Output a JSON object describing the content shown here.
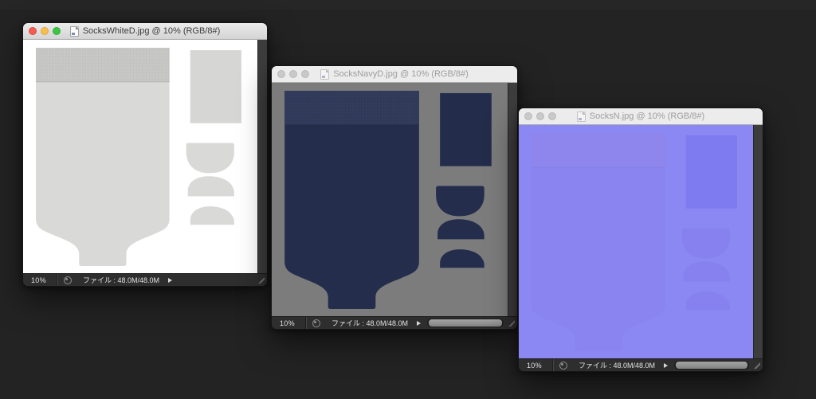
{
  "desktop": {
    "background_color": "#232323"
  },
  "traffic_light_colors": {
    "close": "#f45c52",
    "minimize": "#f8bd4f",
    "zoom": "#3ec544",
    "inactive": "#c9c9c9"
  },
  "windows": [
    {
      "name": "socks-white-diffuse",
      "title": "SocksWhiteD.jpg @ 10% (RGB/8#)",
      "active": true,
      "statusbar": {
        "zoom": "10%",
        "file_info": "ファイル : 48.0M/48.0M"
      },
      "canvas": {
        "background_color": "#ffffff",
        "fabric_body_color": "#d9d9d7",
        "cuff_band_color": "#cccccb",
        "has_horizontal_scrollbar": false
      }
    },
    {
      "name": "socks-navy-diffuse",
      "title": "SocksNavyD.jpg @ 10% (RGB/8#)",
      "active": false,
      "statusbar": {
        "zoom": "10%",
        "file_info": "ファイル : 48.0M/48.0M"
      },
      "canvas": {
        "background_color": "#7c7c7c",
        "fabric_body_color": "#242e4c",
        "cuff_band_color": "#2c3655",
        "has_horizontal_scrollbar": true
      }
    },
    {
      "name": "socks-normal-map",
      "title": "SocksN.jpg @ 10% (RGB/8#)",
      "active": false,
      "statusbar": {
        "zoom": "10%",
        "file_info": "ファイル : 48.0M/48.0M"
      },
      "canvas": {
        "background_color": "#8b87f3",
        "fabric_body_color": "#8984ef",
        "cuff_band_color": "#8e86ec",
        "has_horizontal_scrollbar": true
      }
    }
  ]
}
